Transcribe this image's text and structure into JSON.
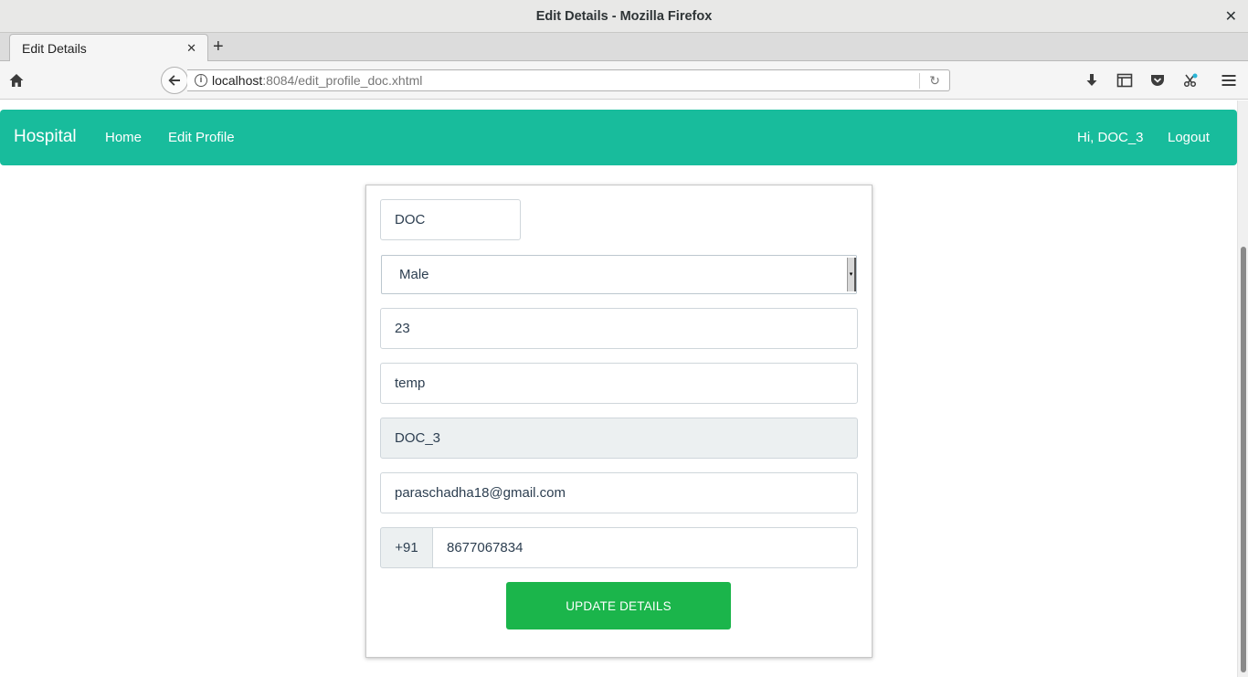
{
  "window": {
    "title": "Edit Details - Mozilla Firefox",
    "close_glyph": "✕"
  },
  "tabs": [
    {
      "label": "Edit Details",
      "close_glyph": "✕"
    }
  ],
  "new_tab_glyph": "+",
  "urlbar": {
    "host": "localhost",
    "rest": ":8084/edit_profile_doc.xhtml",
    "info_glyph": "i",
    "reload_glyph": "↻"
  },
  "toolbar_icons": [
    "home-icon",
    "back-arrow-icon",
    "download-icon",
    "library-icon",
    "pocket-icon",
    "extension-icon",
    "menu-icon"
  ],
  "site": {
    "brand": "Hospital",
    "nav": {
      "home": "Home",
      "edit_profile": "Edit Profile",
      "greeting": "Hi, DOC_3",
      "logout": "Logout"
    },
    "accent": "#18bc9c"
  },
  "form": {
    "first_name": "DOC",
    "gender": "Male",
    "age": "23",
    "specialty": "temp",
    "username": "DOC_3",
    "email": "paraschadha18@gmail.com",
    "phone_prefix": "+91",
    "phone": "8677067834",
    "submit_label": "UPDATE DETAILS",
    "submit_color": "#1bb54b"
  }
}
